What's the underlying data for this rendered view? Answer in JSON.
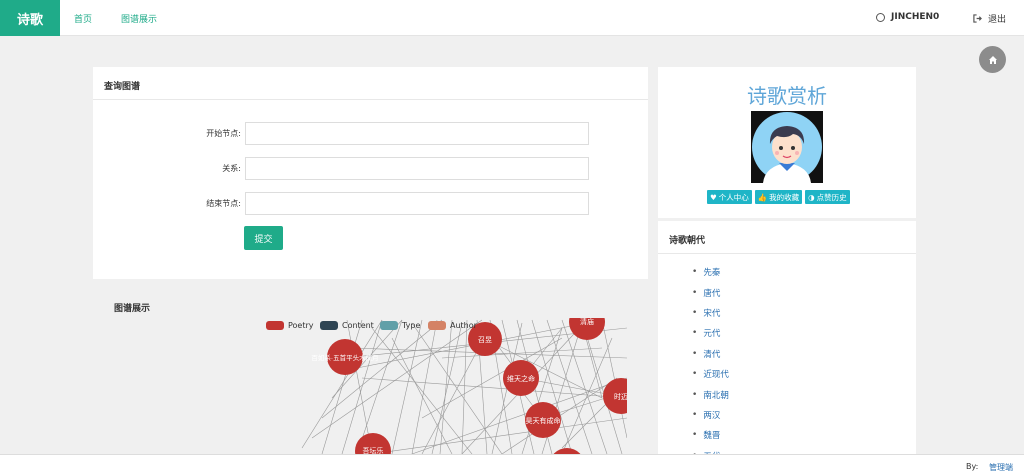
{
  "brand": "诗歌",
  "nav": {
    "home": "首页",
    "graph": "图谱展示",
    "user": "JINCHEN0",
    "logout": "退出"
  },
  "query": {
    "title": "查询图谱",
    "start_label": "开始节点:",
    "relation_label": "关系:",
    "end_label": "结束节点:",
    "submit": "提交"
  },
  "graph": {
    "title": "图谱展示",
    "legend": [
      {
        "name": "Poetry",
        "color": "#c23531"
      },
      {
        "name": "Content",
        "color": "#2f4554"
      },
      {
        "name": "Type",
        "color": "#61a0a8"
      },
      {
        "name": "Author",
        "color": "#d48265"
      }
    ],
    "nodes": [
      "召昱",
      "清庙",
      "维天之命",
      "时迈",
      "昊天有成命",
      "百如杀·五首平头木成月",
      "吾坛乐"
    ]
  },
  "side": {
    "title": "诗歌赏析",
    "buttons": {
      "profile": "个人中心",
      "favorites": "我的收藏",
      "likes": "点赞历史"
    },
    "dynasty_title": "诗歌朝代",
    "dynasties": [
      "先秦",
      "唐代",
      "宋代",
      "元代",
      "清代",
      "近现代",
      "南北朝",
      "两汉",
      "魏晋",
      "五代"
    ]
  },
  "footer": {
    "by": "By:",
    "admin": "管理端"
  },
  "colors": {
    "accent": "#1fab89",
    "node": "#c23531",
    "link": "#2a6fb0",
    "button": "#1fb5c7"
  }
}
